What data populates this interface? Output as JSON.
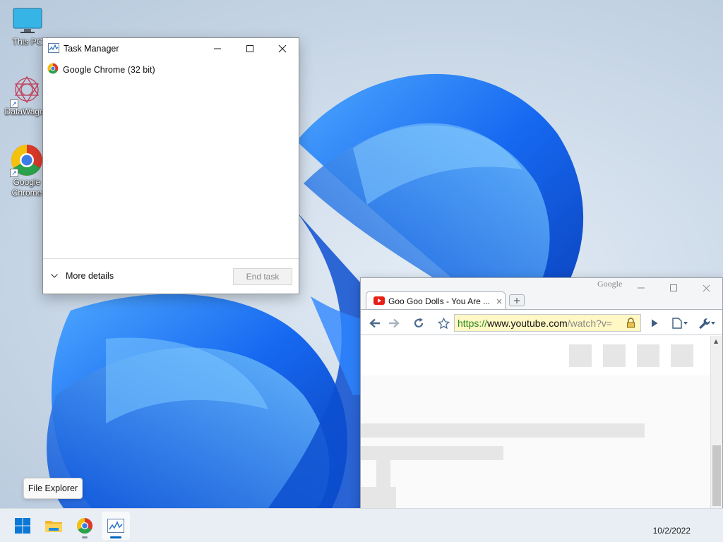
{
  "desktop": {
    "icons": [
      {
        "label": "This PC"
      },
      {
        "label": "DataWagon"
      },
      {
        "label": "Google Chrome"
      }
    ]
  },
  "task_manager": {
    "title": "Task Manager",
    "processes": [
      {
        "name": "Google Chrome (32 bit)"
      }
    ],
    "more_details_label": "More details",
    "end_task_label": "End task"
  },
  "chrome": {
    "brand": "Google",
    "tab_title": "Goo Goo Dolls - You Are ...",
    "url_scheme": "https://",
    "url_host": "www.youtube.com",
    "url_path": "/watch?v=",
    "tab_close": "×"
  },
  "tooltip": {
    "text": "File Explorer"
  },
  "taskbar": {
    "items": [
      {
        "name": "Start"
      },
      {
        "name": "File Explorer"
      },
      {
        "name": "Google Chrome"
      },
      {
        "name": "Task Manager"
      }
    ],
    "clock_text": "10/2/2022"
  },
  "colors": {
    "accent": "#0067c0",
    "secure_url": "#2a8a1f",
    "omnibox_bg": "#fff7c4"
  }
}
